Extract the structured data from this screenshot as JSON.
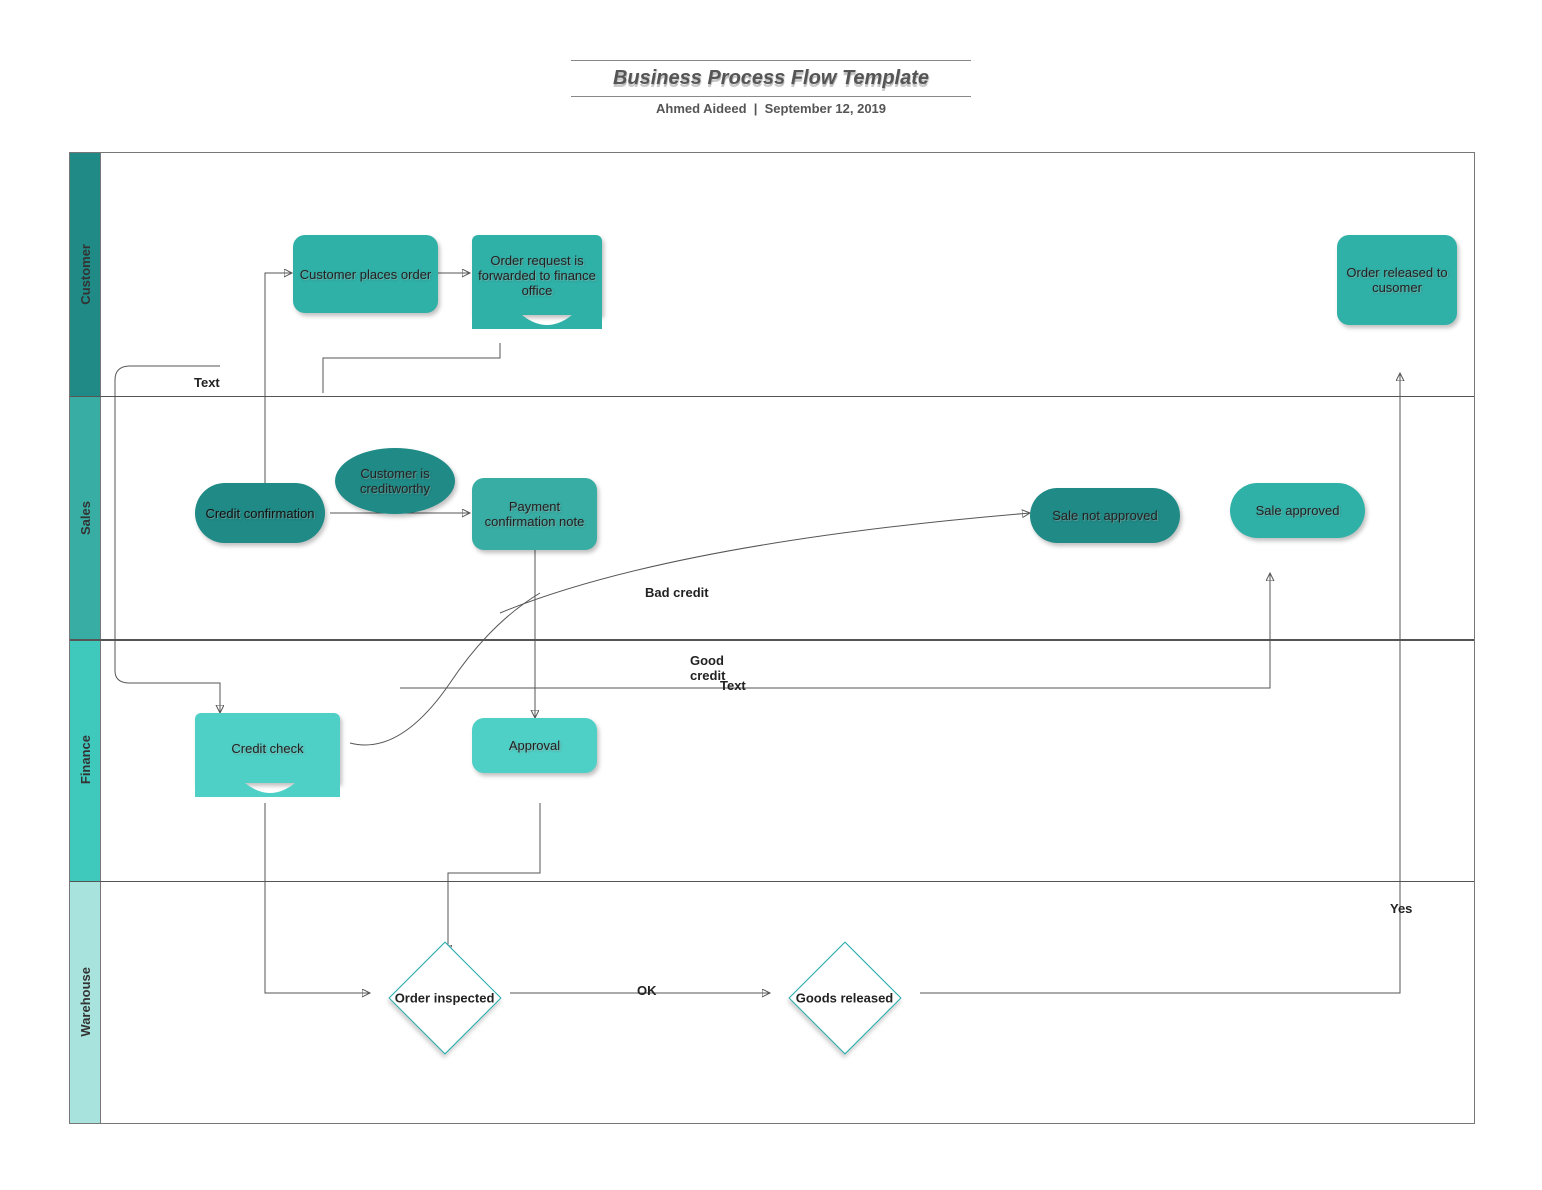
{
  "header": {
    "title": "Business Process Flow Template",
    "title_shadow": "Business Process Flow Template",
    "author": "Ahmed Aideed",
    "date": "September 12, 2019"
  },
  "lanes": {
    "customer": "Customer",
    "sales": "Sales",
    "finance": "Finance",
    "warehouse": "Warehouse"
  },
  "nodes": {
    "customer_places_order": "Customer places order",
    "order_request_forwarded": "Order request is forwarded to finance office",
    "order_released": "Order released to cusomer",
    "credit_confirmation": "Credit confirmation",
    "customer_creditworthy": "Customer is creditworthy",
    "payment_confirmation_note": "Payment confirmation note",
    "sale_not_approved": "Sale not approved",
    "sale_approved": "Sale approved",
    "credit_check": "Credit check",
    "approval": "Approval",
    "order_inspected": "Order inspected",
    "goods_released": "Goods released"
  },
  "edge_labels": {
    "text1": "Text",
    "bad_credit": "Bad credit",
    "good_credit": "Good credit",
    "text2": "Text",
    "ok": "OK",
    "yes": "Yes"
  },
  "colors": {
    "lane_customer": "#1f8a86",
    "lane_sales": "#37ada4",
    "lane_finance": "#3fc9bd",
    "lane_warehouse": "#a8e4dd",
    "teal_dark": "#1f8a86",
    "teal_mid": "#2fb1a8",
    "teal_light": "#4fd0c6"
  }
}
